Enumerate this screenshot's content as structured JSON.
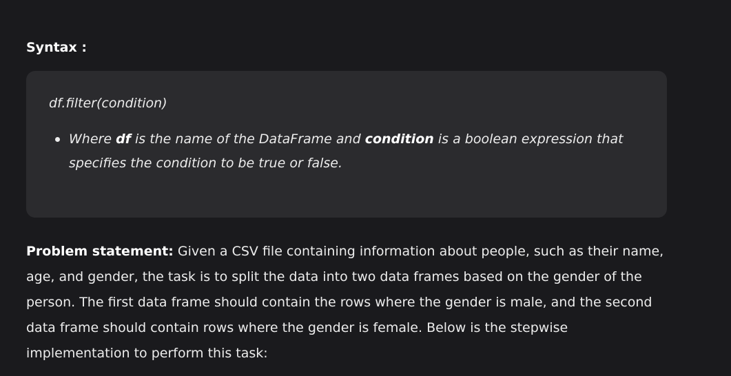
{
  "syntax": {
    "heading": "Syntax :",
    "code": "df.filter(condition)",
    "bullet": {
      "part1": "Where ",
      "bold1": "df",
      "part2": " is the name of the DataFrame and ",
      "bold2": "condition",
      "part3": " is a boolean expression that specifies the condition to be true or false."
    }
  },
  "problem": {
    "label": "Problem statement:",
    "text": " Given a CSV file containing information about people, such as their name, age, and gender, the task is to split the data into two data frames based on the gender of the person. The first data frame should contain the rows where the gender is male, and the second data frame should contain rows where the gender is female. Below is the stepwise implementation to perform this task:"
  }
}
